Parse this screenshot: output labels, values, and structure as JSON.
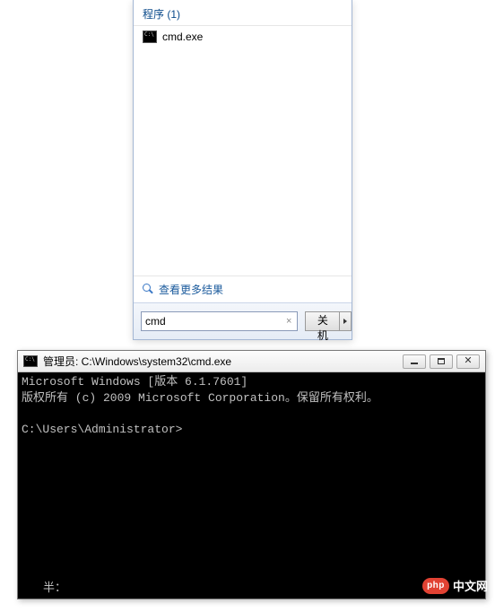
{
  "start_menu": {
    "category_label": "程序 (1)",
    "results": [
      {
        "label": "cmd.exe",
        "icon": "cmd-icon"
      }
    ],
    "more_results_label": "查看更多结果",
    "search": {
      "value": "cmd",
      "clear_glyph": "×"
    },
    "shutdown": {
      "label": "关机"
    }
  },
  "console": {
    "title": "管理员: C:\\Windows\\system32\\cmd.exe",
    "lines": {
      "l1": "Microsoft Windows [版本 6.1.7601]",
      "l2": "版权所有 (c) 2009 Microsoft Corporation。保留所有权利。",
      "l3": "",
      "l4": "C:\\Users\\Administrator>",
      "bottom": "半："
    }
  },
  "watermark": {
    "logo_text": "php",
    "site_text": "中文网"
  }
}
